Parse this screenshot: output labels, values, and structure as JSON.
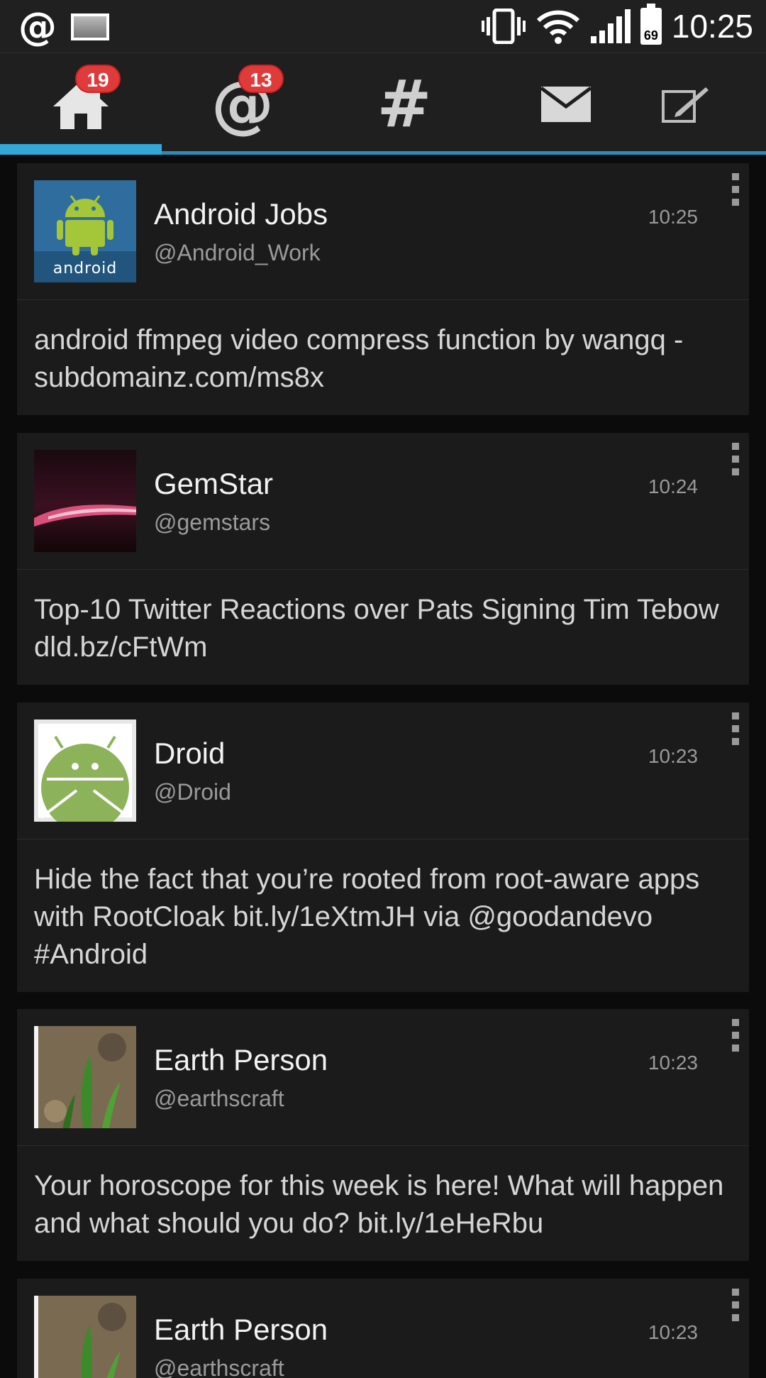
{
  "status_bar": {
    "notification_icon_at": "@",
    "time": "10:25",
    "battery_level": "69",
    "icons": [
      "at-notification-icon",
      "image-notification-icon",
      "vibrate-icon",
      "wifi-icon",
      "signal-icon",
      "battery-icon"
    ]
  },
  "tabs": [
    {
      "name": "home",
      "icon": "home-icon",
      "badge": "19",
      "active": true
    },
    {
      "name": "mentions",
      "icon": "at-icon",
      "badge": "13",
      "active": false
    },
    {
      "name": "hashtags",
      "icon": "hash-icon",
      "badge": "",
      "active": false
    },
    {
      "name": "messages",
      "icon": "mail-icon",
      "badge": "",
      "active": false
    },
    {
      "name": "compose",
      "icon": "compose-icon",
      "badge": "",
      "active": false
    }
  ],
  "tab_glyphs": {
    "mentions": "@",
    "hashtags": "#"
  },
  "accent_color": "#33a7d8",
  "badge_color": "#e03b3b",
  "tweets": [
    {
      "name": "Android Jobs",
      "handle": "@Android_Work",
      "time": "10:25",
      "text": "android ffmpeg video compress function by wangq - subdomainz.com/ms8x",
      "avatar": "android-logo"
    },
    {
      "name": "GemStar",
      "handle": "@gemstars",
      "time": "10:24",
      "text": "Top-10 Twitter Reactions over Pats Signing Tim Tebow dld.bz/cFtWm",
      "avatar": "pink-streak"
    },
    {
      "name": "Droid",
      "handle": "@Droid",
      "time": "10:23",
      "text": "Hide the fact that you’re rooted from root-aware apps with RootCloak bit.ly/1eXtmJH via @goodandevo #Android",
      "avatar": "android-robot"
    },
    {
      "name": "Earth Person",
      "handle": "@earthscraft",
      "time": "10:23",
      "text": "Your horoscope for this week is here! What will happen and what should you do? bit.ly/1eHeRbu",
      "avatar": "plant-sprouts"
    },
    {
      "name": "Earth Person",
      "handle": "@earthscraft",
      "time": "10:23",
      "text": "",
      "avatar": "plant-sprouts"
    }
  ]
}
